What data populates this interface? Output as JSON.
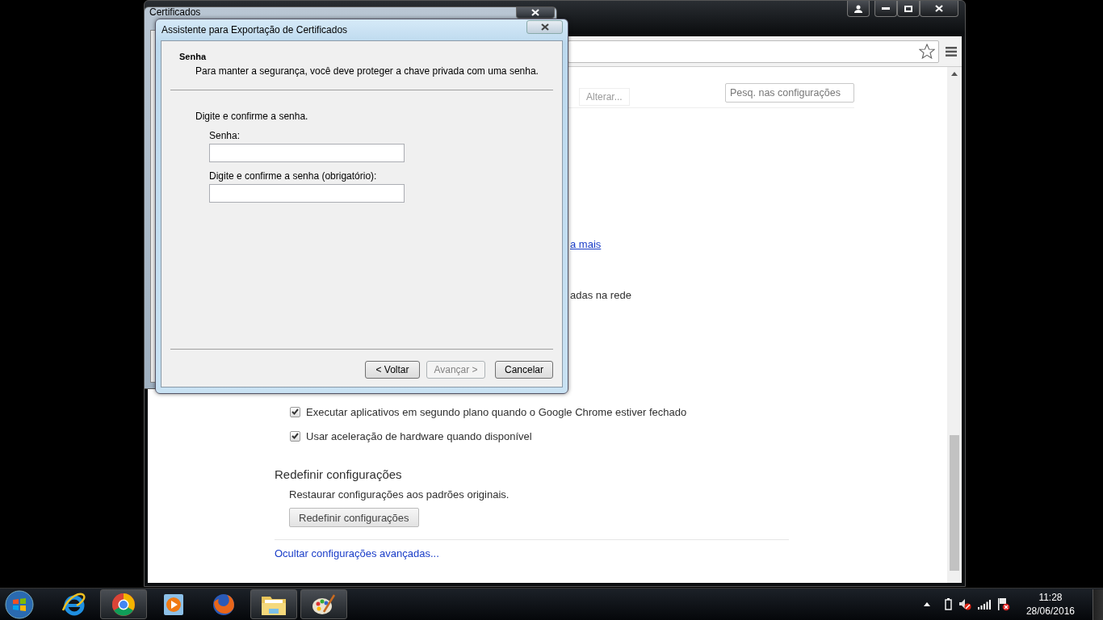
{
  "back_window": {
    "title": "Certificados"
  },
  "browser": {
    "change_button": "Alterar...",
    "search": {
      "placeholder": "Pesq. nas configurações"
    },
    "fragments": [
      {
        "kind": "link",
        "text": "a mais"
      },
      {
        "kind": "text",
        "text": "adas na rede"
      }
    ],
    "checkboxes": [
      {
        "label": "Executar aplicativos em segundo plano quando o Google Chrome estiver fechado",
        "checked": true
      },
      {
        "label": "Usar aceleração de hardware quando disponível",
        "checked": true
      }
    ],
    "reset_section": {
      "heading": "Redefinir configurações",
      "description": "Restaurar configurações aos padrões originais.",
      "button": "Redefinir configurações"
    },
    "advanced_link": "Ocultar configurações avançadas..."
  },
  "dialog": {
    "title": "Assistente para Exportação de Certificados",
    "heading": "Senha",
    "subheading": "Para manter a segurança, você deve proteger a chave privada com uma senha.",
    "instruction": "Digite e confirme a senha.",
    "fields": [
      {
        "label": "Senha:"
      },
      {
        "label": "Digite e confirme a senha (obrigatório):"
      }
    ],
    "buttons": [
      {
        "label": "< Voltar",
        "disabled": false
      },
      {
        "label": "Avançar >",
        "disabled": true
      },
      {
        "label": "Cancelar",
        "disabled": false
      }
    ]
  },
  "taskbar": {
    "apps": [
      {
        "kind": "ie",
        "active": false
      },
      {
        "kind": "chrome",
        "active": true
      },
      {
        "kind": "media",
        "active": false
      },
      {
        "kind": "firefox",
        "active": false
      },
      {
        "kind": "explorer",
        "active": true
      },
      {
        "kind": "paint",
        "active": true
      }
    ],
    "clock": {
      "time": "11:28",
      "date": "28/06/2016"
    }
  }
}
